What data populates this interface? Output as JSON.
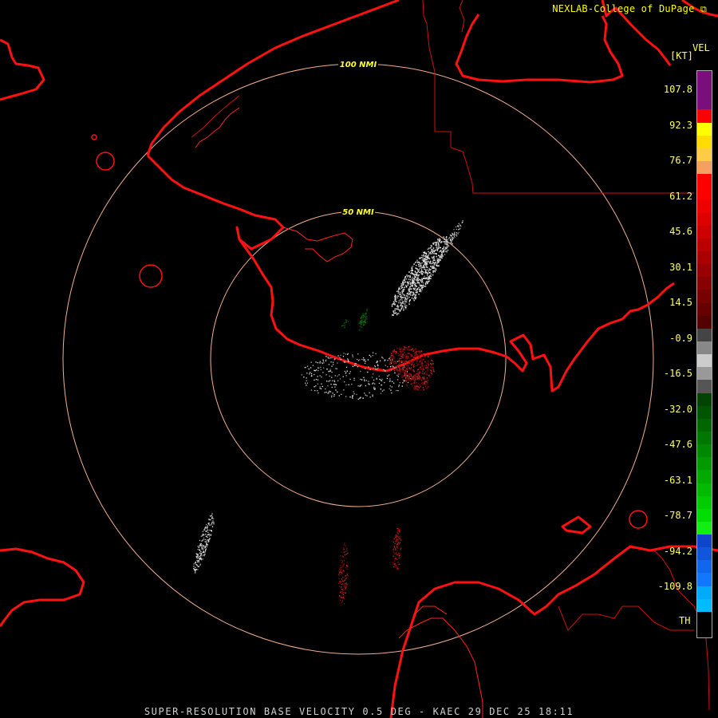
{
  "header": {
    "credit": "NEXLAB-College of DuPage",
    "credit_icon": "external-link-icon"
  },
  "footer": {
    "caption": "SUPER-RESOLUTION BASE VELOCITY 0.5 DEG - KAEC 29 DEC 25 18:11"
  },
  "radar": {
    "range_rings": [
      {
        "label": "100 NMI",
        "range_nmi": 100
      },
      {
        "label": "50 NMI",
        "range_nmi": 50
      }
    ]
  },
  "legend": {
    "product": "VEL",
    "unit": "[KT]",
    "ticks": [
      "107.8",
      "92.3",
      "76.7",
      "61.2",
      "45.6",
      "30.1",
      "14.5",
      "-0.9",
      "-16.5",
      "-32.0",
      "-47.6",
      "-63.1",
      "-78.7",
      "-94.2",
      "-109.8"
    ],
    "th_label": "TH",
    "colors": [
      "#7a0e7a",
      "#7a0e7a",
      "#7a0e7a",
      "#ff0000",
      "#ffff00",
      "#ffdd00",
      "#ffcc44",
      "#f5a060",
      "#ff0000",
      "#ff0000",
      "#ee0000",
      "#dd0000",
      "#cc0000",
      "#bb0000",
      "#aa0000",
      "#990000",
      "#880000",
      "#770000",
      "#660000",
      "#550000",
      "#444444",
      "#888888",
      "#cccccc",
      "#999999",
      "#555555",
      "#004400",
      "#005500",
      "#006600",
      "#007700",
      "#008800",
      "#009900",
      "#00aa00",
      "#00bb00",
      "#00cc00",
      "#00dd00",
      "#11ee11",
      "#1144cc",
      "#1155dd",
      "#1166ee",
      "#1177ff",
      "#00aaff",
      "#00bbff",
      "#000000",
      "#000000"
    ]
  }
}
